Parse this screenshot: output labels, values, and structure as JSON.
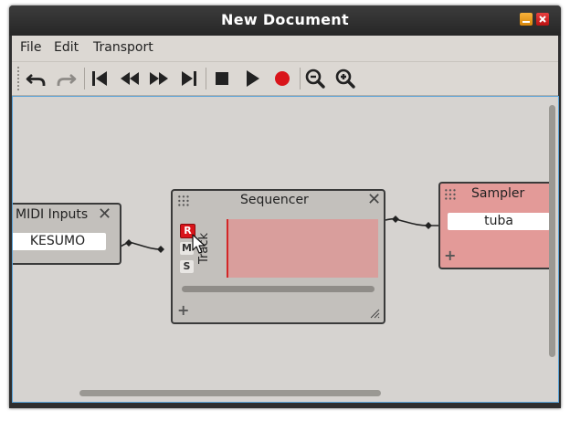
{
  "window": {
    "title": "New Document"
  },
  "menu": {
    "items": [
      "File",
      "Edit",
      "Transport"
    ]
  },
  "toolbar": {
    "buttons": [
      "undo-icon",
      "redo-icon",
      "skip-to-start-icon",
      "rewind-icon",
      "fast-forward-icon",
      "skip-to-end-icon",
      "stop-icon",
      "play-icon",
      "record-icon",
      "zoom-out-icon",
      "zoom-in-icon"
    ]
  },
  "nodes": {
    "midi_inputs": {
      "title": "MIDI Inputs",
      "device": "KESUMO"
    },
    "sequencer": {
      "title": "Sequencer",
      "record_label": "R",
      "mute_label": "M",
      "solo_label": "S",
      "track_label": "Track"
    },
    "sampler": {
      "title": "Sampler",
      "instrument": "tuba"
    }
  },
  "colors": {
    "sampler_bg": "#e39a98",
    "record_red": "#d9141a",
    "track_region": "#d99e9c",
    "selection_border": "#5aa3d8"
  }
}
